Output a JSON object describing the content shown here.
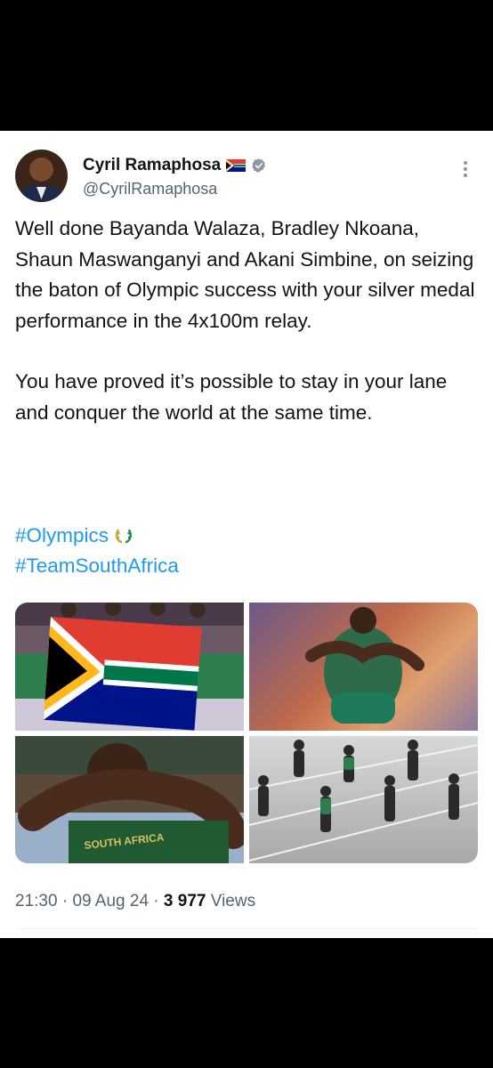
{
  "tweet": {
    "author_name": "Cyril Ramaphosa",
    "author_handle": "@CyrilRamaphosa",
    "paragraph_1": "Well done Bayanda Walaza, Bradley Nkoana, Shaun Maswanganyi and Akani Simbine, on seizing the baton of Olympic success with your silver medal performance in the 4x100m relay.",
    "paragraph_2": "You have proved it’s possible to stay in your lane and conquer the world at the same time.",
    "hashtags": [
      "#Olympics",
      "#TeamSouthAfrica"
    ],
    "time": "21:30",
    "date": "09 Aug 24",
    "views_count": "3 977",
    "views_label": "Views"
  },
  "icons": {
    "flag": "south-africa-flag-icon",
    "verified": "verified-badge-icon",
    "more": "more-options-icon",
    "laurel": "olympic-laurel-icon"
  },
  "colors": {
    "link": "#1d9bf0",
    "text": "#0f1419",
    "muted": "#536471",
    "verified_badge": "#8a98a6"
  }
}
